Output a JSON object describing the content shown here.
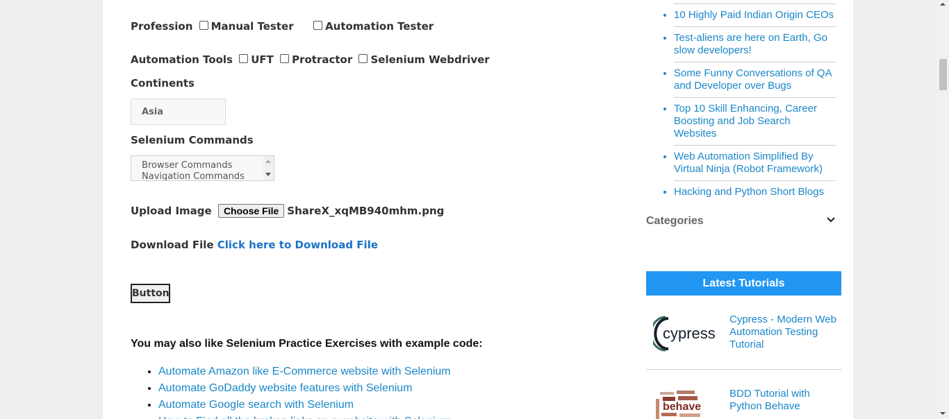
{
  "form": {
    "profession": {
      "label": "Profession",
      "options": [
        "Manual Tester",
        "Automation Tester"
      ]
    },
    "automation_tools": {
      "label": "Automation Tools",
      "options": [
        "UFT",
        "Protractor",
        "Selenium Webdriver"
      ]
    },
    "continents": {
      "label": "Continents",
      "selected": "Asia"
    },
    "selenium_commands": {
      "label": "Selenium Commands",
      "options": [
        "Browser Commands",
        "Navigation Commands"
      ]
    },
    "upload": {
      "label": "Upload Image",
      "button": "Choose File",
      "filename": "ShareX_xqMB940mhm.png"
    },
    "download": {
      "label": "Download File",
      "link": "Click here to Download File"
    },
    "button_label": "Button"
  },
  "also_like": {
    "heading": "You may also like Selenium Practice Exercises with example code:",
    "links": [
      "Automate Amazon like E-Commerce website with Selenium",
      "Automate GoDaddy website features with Selenium",
      "Automate Google search with Selenium",
      "How to Find all the broken links on a website with Selenium"
    ]
  },
  "sidebar": {
    "recent_posts": [
      "10 Highly Paid Indian Origin CEOs",
      "Test-aliens are here on Earth, Go slow developers!",
      "Some Funny Conversations of QA and Developer over Bugs",
      "Top 10 Skill Enhancing, Career Boosting and Job Search Websites",
      "Web Automation Simplified By Virtual Ninja (Robot Framework)",
      "Hacking and Python Short Blogs"
    ],
    "categories_title": "Categories",
    "latest_tutorials_title": "Latest Tutorials",
    "tutorials": [
      {
        "title": "Cypress - Modern Web Automation Testing Tutorial",
        "logo_text": "cypress"
      },
      {
        "title": "BDD Tutorial with Python Behave",
        "logo_text": "behave"
      }
    ]
  },
  "colors": {
    "link": "#1a87c9",
    "accent": "#2196f3"
  }
}
